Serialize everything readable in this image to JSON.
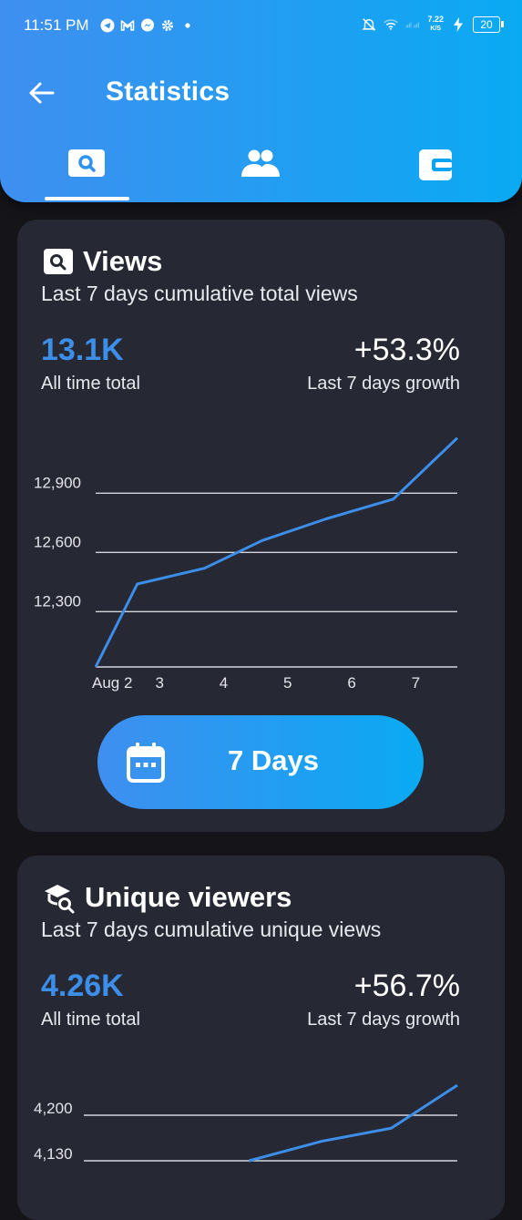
{
  "status_bar": {
    "time": "11:51 PM",
    "net_speed_value": "7.22",
    "net_speed_unit": "K/S",
    "battery": "20"
  },
  "header": {
    "title": "Statistics",
    "tabs": [
      {
        "icon": "search-icon"
      },
      {
        "icon": "people-icon"
      },
      {
        "icon": "wallet-icon"
      }
    ],
    "active_tab": 0
  },
  "views_card": {
    "title": "Views",
    "subtitle": "Last 7 days cumulative total views",
    "total_value": "13.1K",
    "total_label": "All time total",
    "growth_value": "+53.3%",
    "growth_label": "Last 7 days growth",
    "range_button_label": "7 Days",
    "chart_data": {
      "type": "line",
      "x_ticks": [
        "Aug 2",
        "3",
        "4",
        "5",
        "6",
        "7"
      ],
      "y_ticks": [
        "12,300",
        "12,600",
        "12,900"
      ],
      "grid": true,
      "series": [
        {
          "color": "#3d8ee8",
          "points": [
            {
              "x": 2.0,
              "y": 12020
            },
            {
              "x": 2.65,
              "y": 12440
            },
            {
              "x": 3.7,
              "y": 12520
            },
            {
              "x": 4.6,
              "y": 12660
            },
            {
              "x": 5.6,
              "y": 12770
            },
            {
              "x": 6.65,
              "y": 12870
            },
            {
              "x": 7.65,
              "y": 13180
            }
          ]
        }
      ]
    }
  },
  "viewers_card": {
    "title": "Unique viewers",
    "subtitle": "Last 7 days cumulative unique views",
    "total_value": "4.26K",
    "total_label": "All time total",
    "growth_value": "+56.7%",
    "growth_label": "Last 7 days growth",
    "chart_data": {
      "type": "line",
      "y_ticks": [
        "4,130",
        "4,200"
      ],
      "grid": true,
      "series": [
        {
          "color": "#3d8ee8",
          "points": [
            {
              "x": 4.5,
              "y": 4130
            },
            {
              "x": 5.6,
              "y": 4160
            },
            {
              "x": 6.65,
              "y": 4180
            },
            {
              "x": 7.65,
              "y": 4246
            }
          ]
        }
      ]
    }
  }
}
